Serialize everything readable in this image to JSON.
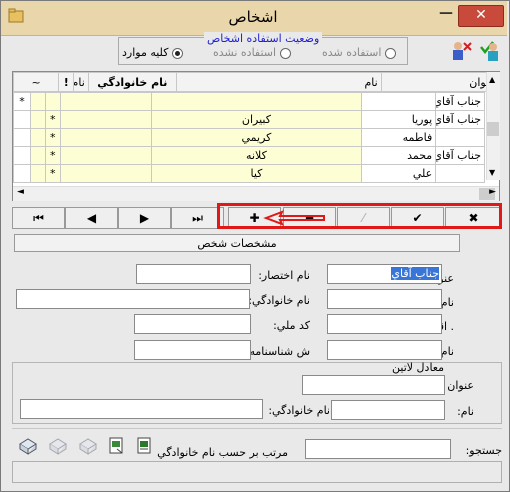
{
  "window": {
    "title": "اشخاص",
    "close": "✕",
    "minimize": "—"
  },
  "usage_filter": {
    "title": "وضعيت استفاده اشخاص",
    "options": [
      "استفاده شده",
      "استفاده نشده",
      "کليه موارد"
    ],
    "selected": "کليه موارد"
  },
  "grid": {
    "columns": [
      "عنوان",
      "نام",
      "نام خانوادگي",
      "نام اختصار",
      "!",
      "~"
    ],
    "rows": [
      {
        "marker": "*",
        "title": "جناب آقاي",
        "first": "",
        "last": "",
        "abbr": "",
        "flag": ""
      },
      {
        "marker": "",
        "title": "جناب آقاي",
        "first": "پوريا",
        "last": "کبيران",
        "abbr": "",
        "flag": "*"
      },
      {
        "marker": "",
        "title": "",
        "first": "فاطمه",
        "last": "کريمي",
        "abbr": "",
        "flag": "*"
      },
      {
        "marker": "",
        "title": "جناب آقاي",
        "first": "محمد",
        "last": "کلانه",
        "abbr": "",
        "flag": "*"
      },
      {
        "marker": "",
        "title": "",
        "first": "علي",
        "last": "کيا",
        "abbr": "",
        "flag": "*"
      }
    ]
  },
  "nav": {
    "first": "⏮",
    "prev": "◀",
    "next": "▶",
    "last": "⏭",
    "add": "✚",
    "remove": "━",
    "edit": "⁄",
    "confirm": "✔",
    "cancel": "✖"
  },
  "section": {
    "person_details": "مشخصات شخص"
  },
  "form": {
    "title_label": "عنوان :",
    "title_value": "جناب آقاي",
    "abbr_label": "نام اختصار:",
    "name_label": "نام:",
    "family_label": "نام خانوادگي:",
    "economic_label": ". اقتصادي:",
    "national_label": "کد ملي:",
    "father_label": "نام پدر :",
    "idno_label": "ش شناسنامه:"
  },
  "latin": {
    "title": "معادل لاتين",
    "title_label": "عنوان :",
    "name_label": "نام:",
    "family_label": "نام خانوادگي:"
  },
  "search": {
    "label": "جستجو:",
    "sort_label": "مرتب بر حسب نام خانوادگي"
  }
}
